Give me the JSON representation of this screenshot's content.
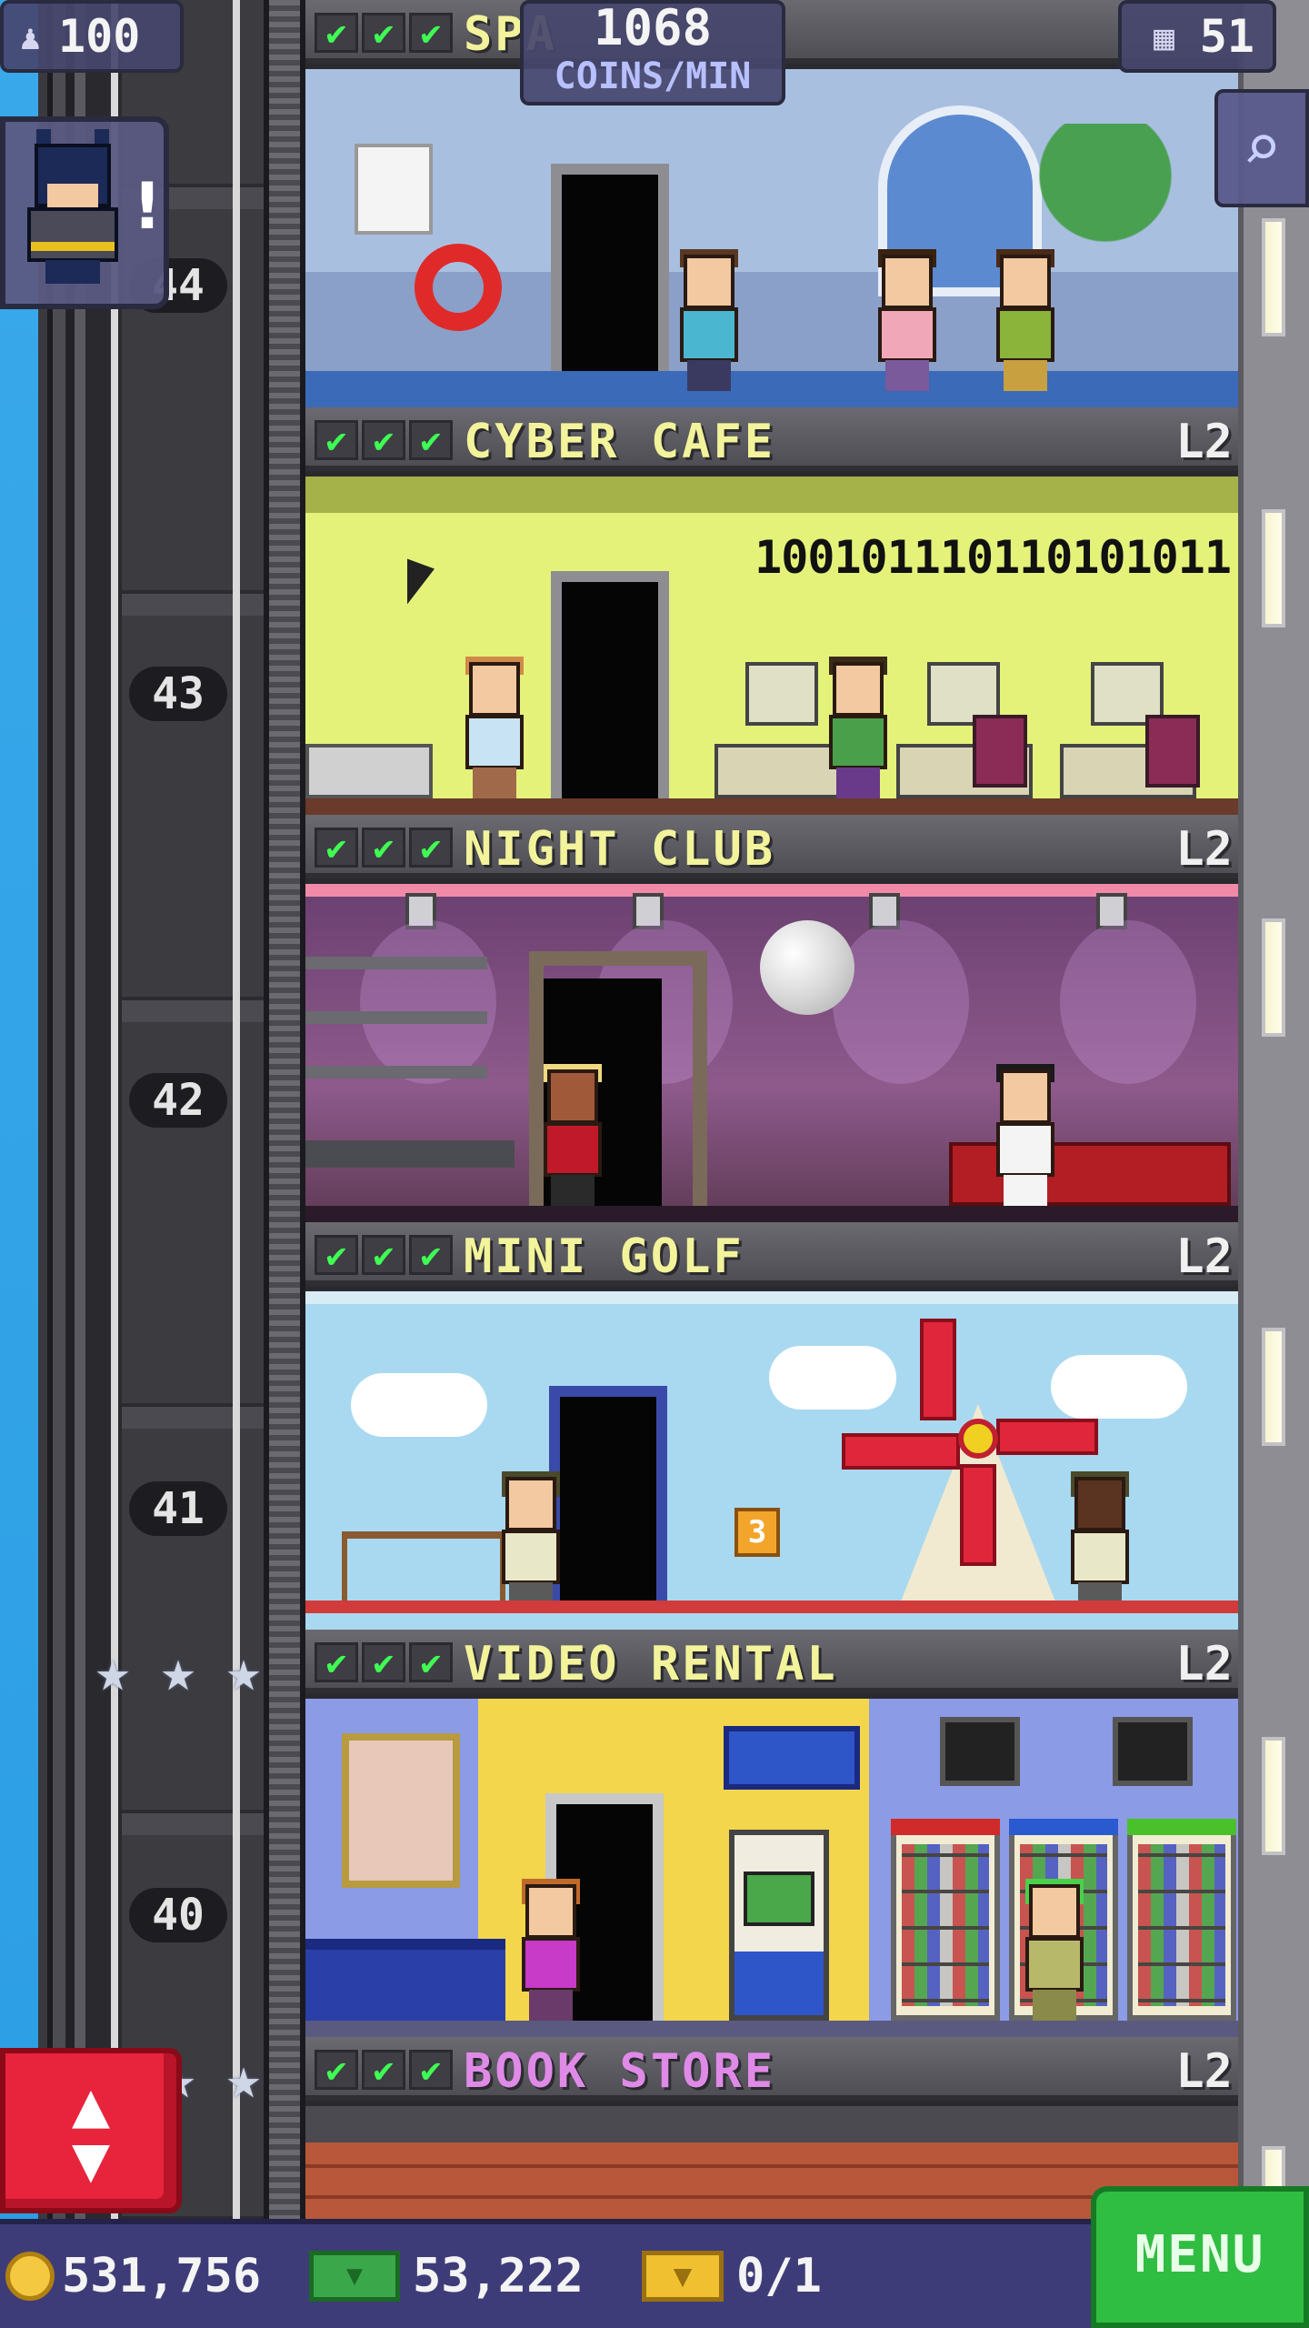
{
  "hud": {
    "population": "100",
    "coins_per_min_value": "1068",
    "coins_per_min_label": "COINS/MIN",
    "floor_count": "51",
    "population_icon": "person-icon",
    "floors_icon": "building-icon",
    "search_icon": "magnifier-icon"
  },
  "bitizen_alert": {
    "mark": "!",
    "icon": "batman-bitizen-icon"
  },
  "elevator": {
    "floor_labels": [
      "44",
      "43",
      "42",
      "41",
      "40"
    ],
    "button_icon": "up-down-arrows-icon"
  },
  "floors": [
    {
      "name": "SPA",
      "level": "",
      "checks": [
        "✔",
        "✔",
        "✔"
      ]
    },
    {
      "name": "CYBER CAFE",
      "level": "L2",
      "checks": [
        "✔",
        "✔",
        "✔"
      ],
      "display_text": "100101110110101011"
    },
    {
      "name": "NIGHT CLUB",
      "level": "L2",
      "checks": [
        "✔",
        "✔",
        "✔"
      ]
    },
    {
      "name": "MINI GOLF",
      "level": "L2",
      "checks": [
        "✔",
        "✔",
        "✔"
      ],
      "sign": "3"
    },
    {
      "name": "VIDEO RENTAL",
      "level": "L2",
      "checks": [
        "✔",
        "✔",
        "✔"
      ]
    },
    {
      "name": "BOOK STORE",
      "level": "L2",
      "checks": [
        "✔",
        "✔",
        "✔"
      ]
    }
  ],
  "colors": {
    "check": "#40ff53",
    "floor_name": "#f3f39b",
    "book_store_name": "#e08ae8",
    "menu": "#2fbd42",
    "elevator_button": "#e8243c"
  },
  "bottom_bar": {
    "coins": "531,756",
    "bux": "53,222",
    "tickets": "0/1",
    "menu_label": "MENU",
    "coin_icon": "coin-icon",
    "bux_icon": "bux-icon",
    "ticket_icon": "golden-ticket-icon"
  }
}
